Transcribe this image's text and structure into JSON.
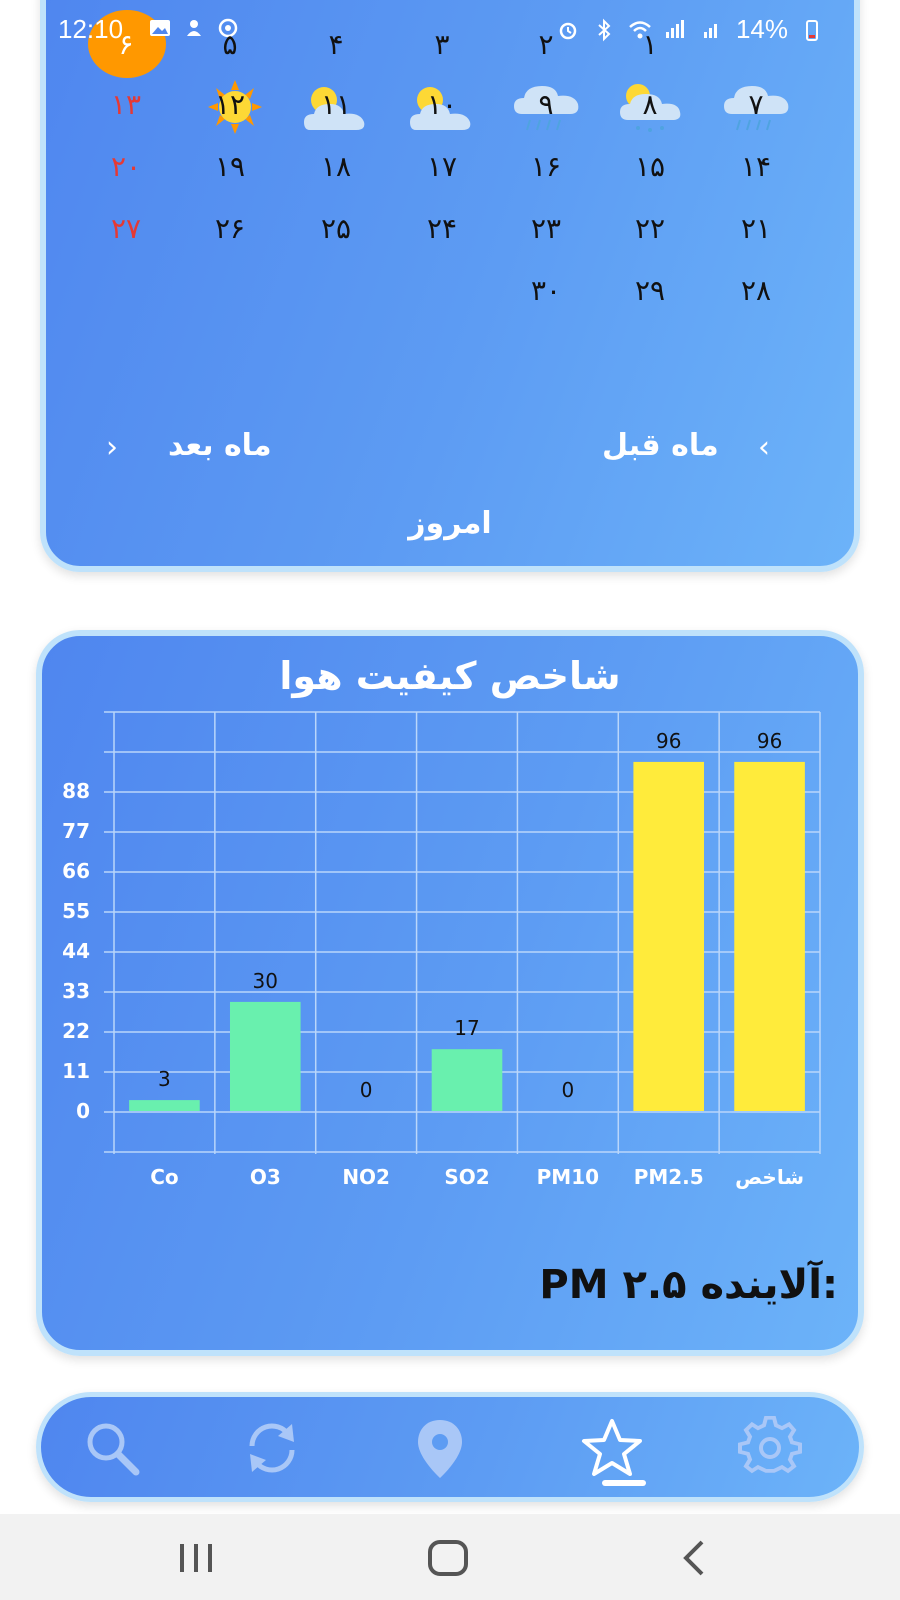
{
  "status_bar": {
    "time": "12:10",
    "battery": "14%",
    "icons": [
      "gallery-icon",
      "notification-icon",
      "sync-icon",
      "alarm-icon",
      "bluetooth-icon",
      "wifi-icon",
      "volte-signal-icon",
      "signal-icon",
      "battery-icon"
    ]
  },
  "calendar": {
    "header_row": [
      "۶",
      "۵",
      "۴",
      "۳",
      "۲",
      "۱"
    ],
    "rows": [
      [
        "۱۳",
        "۱۲",
        "۱۱",
        "۱۰",
        "۹",
        "۸",
        "۷"
      ],
      [
        "۲۰",
        "۱۹",
        "۱۸",
        "۱۷",
        "۱۶",
        "۱۵",
        "۱۴"
      ],
      [
        "۲۷",
        "۲۶",
        "۲۵",
        "۲۴",
        "۲۳",
        "۲۲",
        "۲۱"
      ],
      [
        "",
        "",
        "",
        "",
        "۳۰",
        "۲۹",
        "۲۸"
      ]
    ],
    "row1_weather": [
      "",
      "sunny",
      "partly-cloudy",
      "partly-cloudy",
      "rain",
      "partly-cloudy-rain",
      "rain"
    ],
    "holiday_color": "#e53935",
    "today_color": "#ff9800",
    "next_month_label": "ماه بعد",
    "prev_month_label": "ماه قبل",
    "today_label": "امروز"
  },
  "air_quality": {
    "title": "شاخص کیفیت هوا",
    "pollutant_label": "آلاینده:",
    "pollutant_value": "PM ۲.۵"
  },
  "chart_data": {
    "type": "bar",
    "categories": [
      "Co",
      "O3",
      "NO2",
      "SO2",
      "PM10",
      "PM2.5",
      "شاخص"
    ],
    "values": [
      3,
      30,
      0,
      17,
      0,
      96,
      96
    ],
    "value_labels": [
      "3",
      "30",
      "0",
      "17",
      "0",
      "96",
      "96"
    ],
    "bar_colors": [
      "#69f0ae",
      "#69f0ae",
      "#69f0ae",
      "#69f0ae",
      "#69f0ae",
      "#ffeb3b",
      "#ffeb3b"
    ],
    "yticks": [
      0,
      11,
      22,
      33,
      44,
      55,
      66,
      77,
      88
    ],
    "ylim": [
      0,
      96
    ],
    "grid": true,
    "title": "",
    "xlabel": "",
    "ylabel": ""
  },
  "bottom_nav": {
    "items": [
      "search-icon",
      "refresh-icon",
      "location-icon",
      "star-icon",
      "settings-icon"
    ],
    "active": "star-icon"
  },
  "system_nav": {
    "items": [
      "recent-apps-icon",
      "home-icon",
      "back-icon"
    ]
  }
}
